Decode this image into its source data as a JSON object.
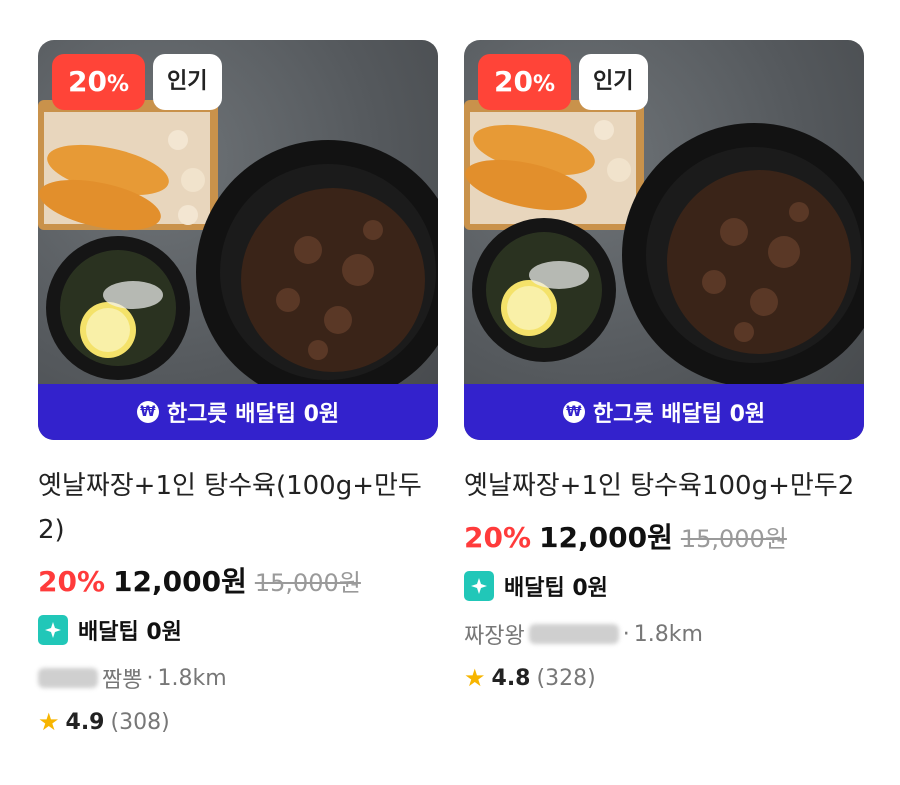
{
  "cards": [
    {
      "discount_badge": "20",
      "discount_pct_sign": "%",
      "tag_badge": "인기",
      "banner_icon": "won-coin-icon",
      "banner_text": "한그릇 배달팁 0원",
      "title": "옛날짜장+1인 탕수육(100g+만두2)",
      "discount": "20%",
      "price": "12,000원",
      "original_price": "15,000원",
      "delivery_tip": "배달팁 0원",
      "store_name_visible": "짬뽕",
      "separator": "·",
      "distance": "1.8km",
      "rating": "4.9",
      "reviews": "(308)"
    },
    {
      "discount_badge": "20",
      "discount_pct_sign": "%",
      "tag_badge": "인기",
      "banner_icon": "won-coin-icon",
      "banner_text": "한그릇 배달팁 0원",
      "title": "옛날짜장+1인 탕수육100g+만두2",
      "discount": "20%",
      "price": "12,000원",
      "original_price": "15,000원",
      "delivery_tip": "배달팁 0원",
      "store_name_visible": "짜장왕",
      "separator": "·",
      "distance": "1.8km",
      "rating": "4.8",
      "reviews": "(328)"
    }
  ],
  "colors": {
    "discount_red": "#ff3b3b",
    "banner_purple": "#3322cc",
    "tip_icon_teal": "#21c7b8",
    "star_yellow": "#f7b500"
  }
}
